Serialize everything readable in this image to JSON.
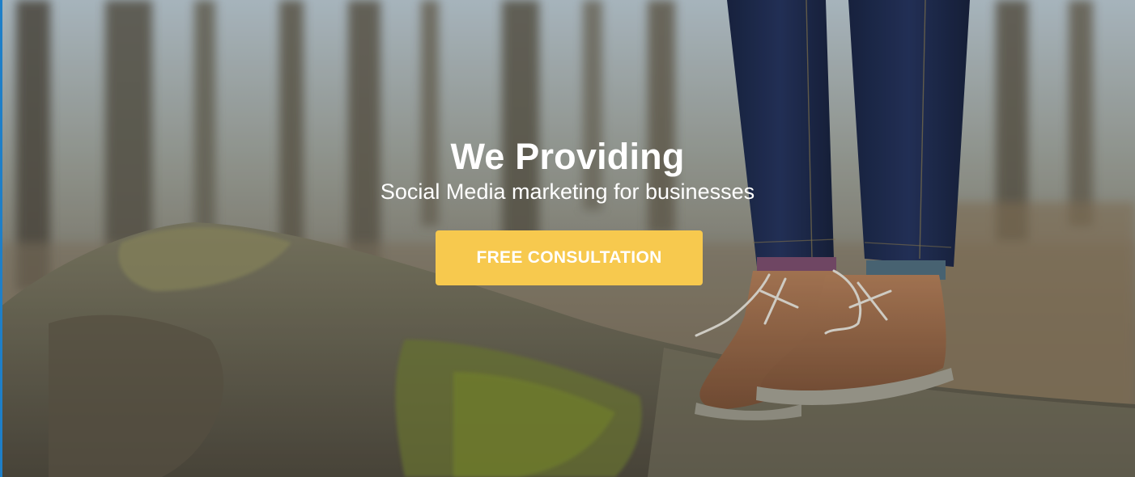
{
  "hero": {
    "title": "We Providing",
    "subtitle": "Social Media marketing for businesses",
    "cta_label": "FREE CONSULTATION"
  },
  "colors": {
    "cta_background": "#f7c94e",
    "cta_text": "#ffffff",
    "heading_text": "#ffffff",
    "left_accent": "#1e7fc8"
  }
}
